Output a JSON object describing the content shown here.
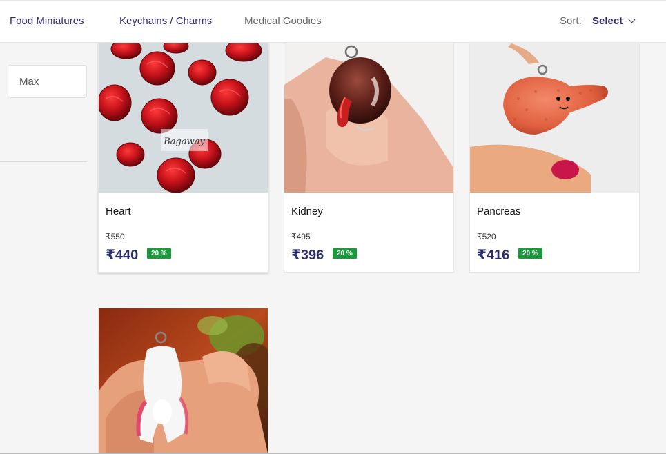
{
  "nav": {
    "links": [
      {
        "label": "Food Miniatures",
        "state": "active"
      },
      {
        "label": "Keychains / Charms",
        "state": "active"
      },
      {
        "label": "Medical Goodies",
        "state": "muted"
      }
    ],
    "sort_label": "Sort:",
    "sort_value": "Select"
  },
  "filter": {
    "max_placeholder": "Max"
  },
  "products": [
    {
      "name": "Heart",
      "old_price": "₹550",
      "price": "₹440",
      "discount": "20 %",
      "image": "red-clay-heart-charms-photo",
      "watermark": "Bagaway"
    },
    {
      "name": "Kidney",
      "old_price": "₹495",
      "price": "₹396",
      "discount": "20 %",
      "image": "clay-kidney-keychain-photo"
    },
    {
      "name": "Pancreas",
      "old_price": "₹520",
      "price": "₹416",
      "discount": "20 %",
      "image": "clay-pancreas-keychain-photo"
    },
    {
      "name": "",
      "image": "clay-knee-joint-keychain-photo"
    }
  ],
  "colors": {
    "brand_navy": "#2b2d6e",
    "discount_green": "#1a9a3c",
    "page_bg": "#f5f5f5"
  }
}
